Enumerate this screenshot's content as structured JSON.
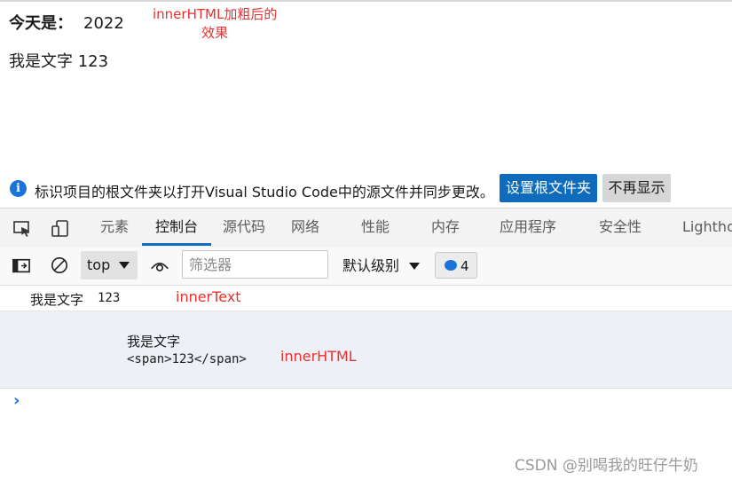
{
  "page": {
    "today_label": "今天是：",
    "today_value": "2022",
    "text_line": "我是文字 123",
    "annotation_bold": [
      "innerHTML加粗后的",
      "效果"
    ]
  },
  "infobar": {
    "message": "标识项目的根文件夹以打开Visual Studio Code中的源文件并同步更改。",
    "primary_button": "设置根文件夹",
    "secondary_button": "不再显示"
  },
  "devtools_tabs": {
    "items": [
      "元素",
      "控制台",
      "源代码",
      "网络",
      "性能",
      "内存",
      "应用程序",
      "安全性",
      "Lightho"
    ],
    "active": "控制台"
  },
  "console_toolbar": {
    "context": "top",
    "filter_placeholder": "筛选器",
    "level": "默认级别",
    "issue_count": "4"
  },
  "console": {
    "log1_text": "我是文字",
    "log1_mono": "123",
    "log1_annotation": "innerText",
    "log2_line1": "我是文字",
    "log2_line2": "<span>123</span>",
    "log2_annotation": "innerHTML"
  },
  "watermark": "CSDN @别喝我的旺仔牛奶",
  "colors": {
    "accent": "#0f6cbd",
    "annotation": "#e8312e",
    "console_highlight": "#edf1f7"
  }
}
